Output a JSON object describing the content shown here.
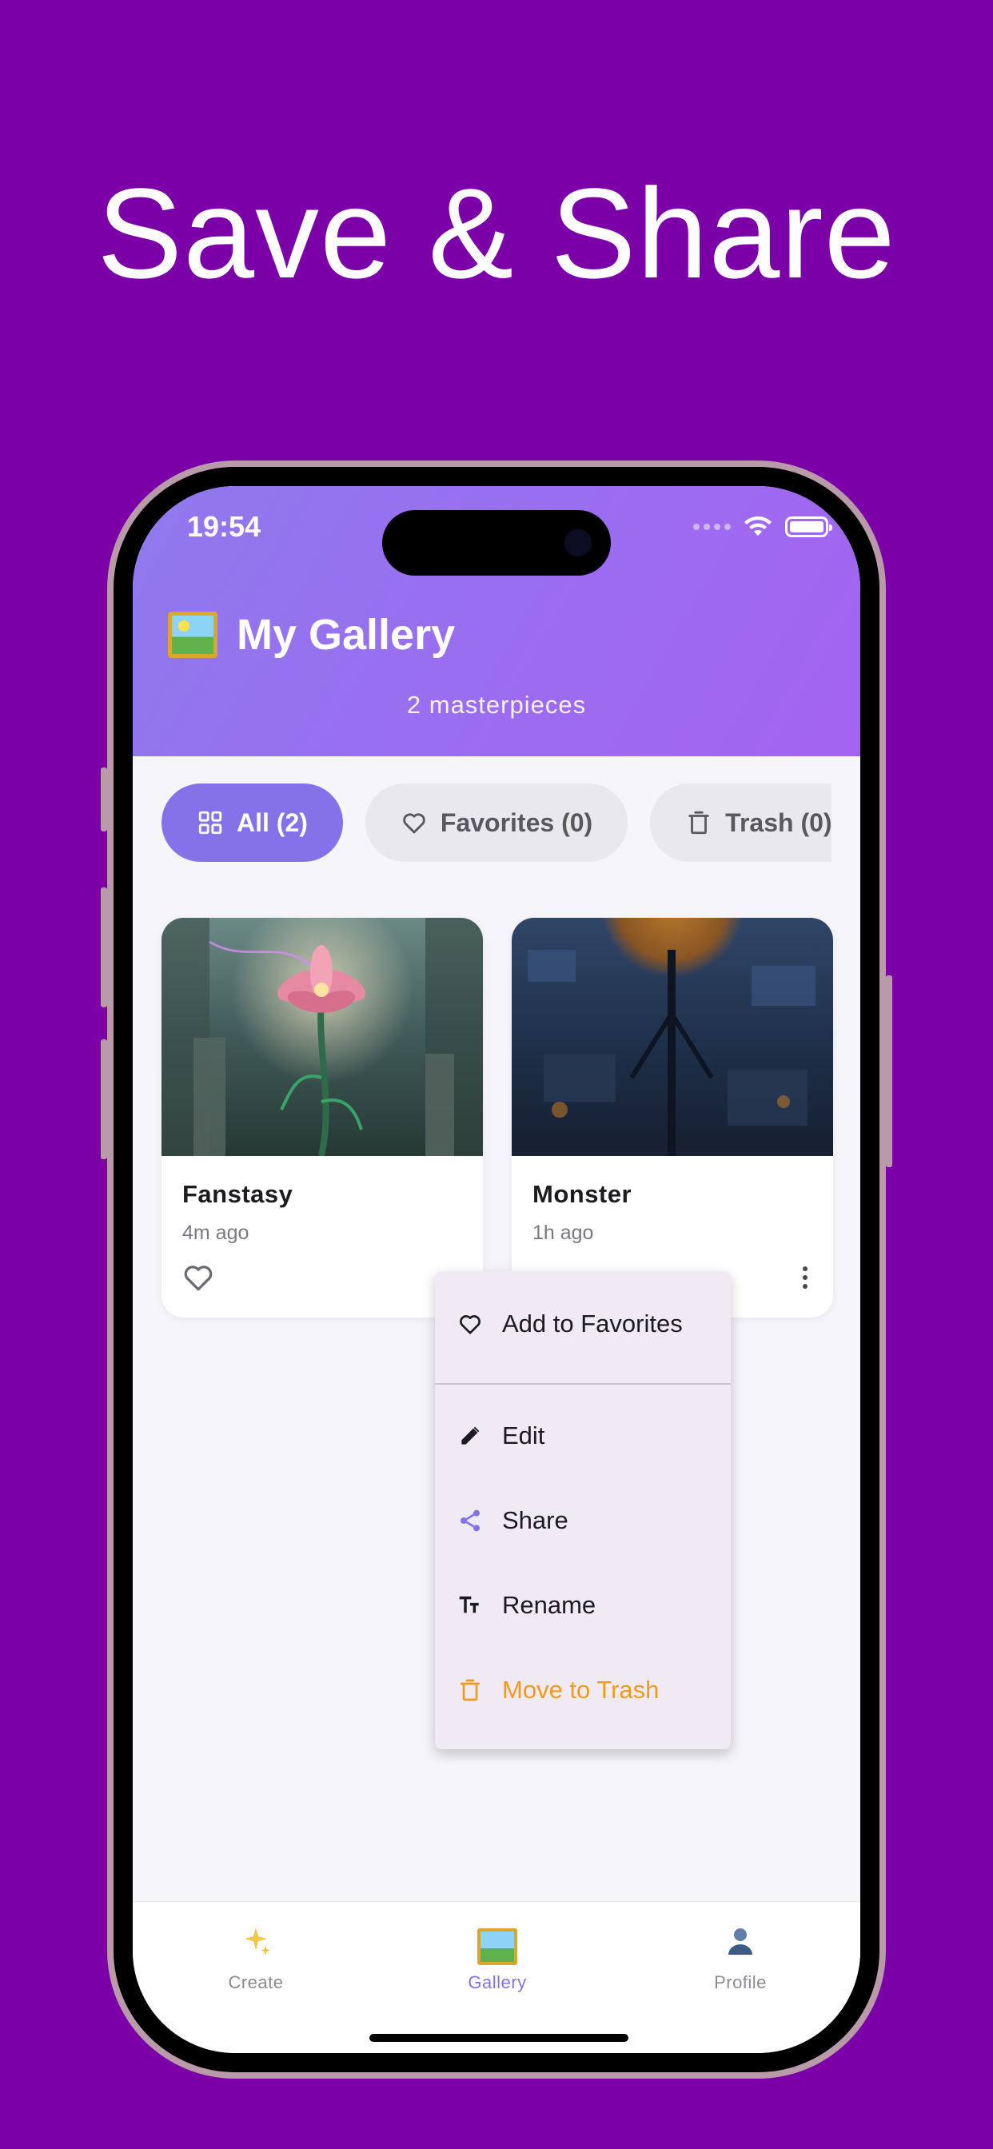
{
  "headline": "Save & Share",
  "status": {
    "time": "19:54"
  },
  "header": {
    "icon": "framed-picture-icon",
    "title": "My Gallery",
    "subtitle": "2 masterpieces"
  },
  "tabs": [
    {
      "label": "All (2)",
      "icon": "grid-icon",
      "active": true
    },
    {
      "label": "Favorites (0)",
      "icon": "heart-outline-icon",
      "active": false
    },
    {
      "label": "Trash (0)",
      "icon": "trash-icon",
      "active": false
    }
  ],
  "cards": [
    {
      "name": "Fanstasy",
      "time": "4m ago"
    },
    {
      "name": "Monster",
      "time": "1h ago"
    }
  ],
  "context_menu": {
    "items": [
      {
        "label": "Add to Favorites",
        "icon": "heart-outline-icon"
      },
      {
        "label": "Edit",
        "icon": "pencil-icon"
      },
      {
        "label": "Share",
        "icon": "share-icon"
      },
      {
        "label": "Rename",
        "icon": "text-size-icon"
      },
      {
        "label": "Move to Trash",
        "icon": "trash-icon",
        "color": "#f39a1d"
      }
    ]
  },
  "bottom_nav": [
    {
      "label": "Create",
      "icon": "sparkles-icon"
    },
    {
      "label": "Gallery",
      "icon": "framed-picture-icon",
      "active": true
    },
    {
      "label": "Profile",
      "icon": "user-icon"
    }
  ],
  "colors": {
    "background": "#7b00a8",
    "accent": "#8672e8",
    "header_gradient_start": "#8f79ee",
    "header_gradient_end": "#a463f1",
    "danger": "#f39a1d"
  }
}
